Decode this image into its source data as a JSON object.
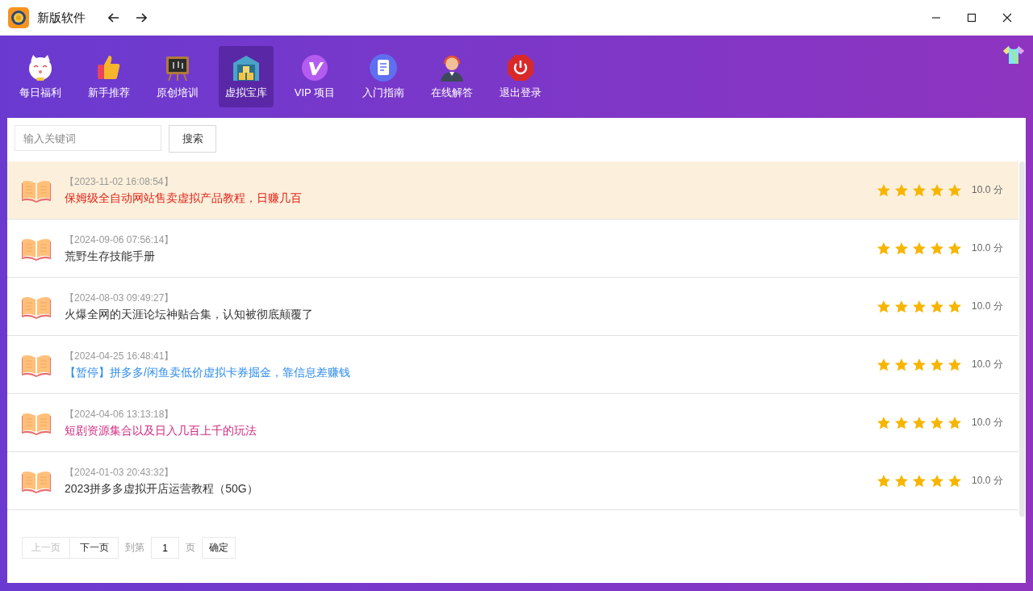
{
  "window": {
    "title": "新版软件"
  },
  "nav": [
    {
      "label": "每日福利",
      "kind": "cat",
      "selected": false
    },
    {
      "label": "新手推荐",
      "kind": "thumb",
      "selected": false
    },
    {
      "label": "原创培训",
      "kind": "board",
      "selected": false
    },
    {
      "label": "虚拟宝库",
      "kind": "warehouse",
      "selected": true
    },
    {
      "label": "VIP 项目",
      "kind": "vip",
      "selected": false
    },
    {
      "label": "入门指南",
      "kind": "doc",
      "selected": false
    },
    {
      "label": "在线解答",
      "kind": "agent",
      "selected": false
    },
    {
      "label": "退出登录",
      "kind": "power",
      "selected": false
    }
  ],
  "search": {
    "placeholder": "输入关键词",
    "button": "搜索"
  },
  "items": [
    {
      "time": "【2023-11-02 16:08:54】",
      "title": "保姆级全自动网站售卖虚拟产品教程，日赚几百",
      "color": "#e02418",
      "selected": true,
      "stars": 5,
      "score": "10.0 分"
    },
    {
      "time": "【2024-09-06 07:56:14】",
      "title": "荒野生存技能手册",
      "color": "#333333",
      "selected": false,
      "stars": 5,
      "score": "10.0 分"
    },
    {
      "time": "【2024-08-03 09:49:27】",
      "title": "火爆全网的天涯论坛神贴合集，认知被彻底颠覆了",
      "color": "#333333",
      "selected": false,
      "stars": 5,
      "score": "10.0 分"
    },
    {
      "time": "【2024-04-25 16:48:41】",
      "title": "【暂停】拼多多/闲鱼卖低价虚拟卡券掘金，靠信息差赚钱",
      "color": "#2d8cf0",
      "selected": false,
      "stars": 5,
      "score": "10.0 分"
    },
    {
      "time": "【2024-04-06 13:13:18】",
      "title": "短剧资源集合以及日入几百上千的玩法",
      "color": "#d02a80",
      "selected": false,
      "stars": 5,
      "score": "10.0 分"
    },
    {
      "time": "【2024-01-03 20:43:32】",
      "title": "2023拼多多虚拟开店运营教程（50G）",
      "color": "#333333",
      "selected": false,
      "stars": 5,
      "score": "10.0 分"
    }
  ],
  "pager": {
    "prev": "上一页",
    "prev_disabled": true,
    "next": "下一页",
    "goto": "到第",
    "page": "1",
    "unit": "页",
    "confirm": "确定"
  }
}
